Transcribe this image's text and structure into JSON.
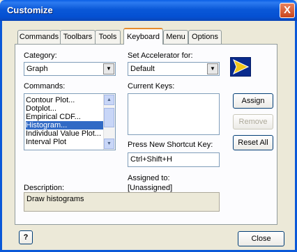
{
  "window": {
    "title": "Customize",
    "close_glyph": "X"
  },
  "tabs": [
    {
      "label": "Commands"
    },
    {
      "label": "Toolbars"
    },
    {
      "label": "Tools"
    },
    {
      "label": "Keyboard"
    },
    {
      "label": "Menu"
    },
    {
      "label": "Options"
    }
  ],
  "active_tab": "Keyboard",
  "category": {
    "label": "Category:",
    "value": "Graph"
  },
  "commands": {
    "label": "Commands:",
    "items": [
      "Contour Plot...",
      "Dotplot...",
      "Empirical CDF...",
      "Histogram...",
      "Individual Value Plot...",
      "Interval Plot"
    ],
    "selected": "Histogram..."
  },
  "accelerator": {
    "label": "Set Accelerator for:",
    "value": "Default"
  },
  "current_keys": {
    "label": "Current Keys:"
  },
  "buttons": {
    "assign": "Assign",
    "remove": "Remove",
    "reset_all": "Reset All",
    "close": "Close",
    "help": "?"
  },
  "shortcut": {
    "label": "Press New Shortcut Key:",
    "value": "Ctrl+Shift+H"
  },
  "assigned": {
    "label": "Assigned to:",
    "value": "[Unassigned]"
  },
  "description": {
    "label": "Description:",
    "value": "Draw histograms"
  },
  "colors": {
    "titlebar": "#0a58d8",
    "selection": "#316ac5",
    "tab_highlight": "#e68b2c"
  }
}
